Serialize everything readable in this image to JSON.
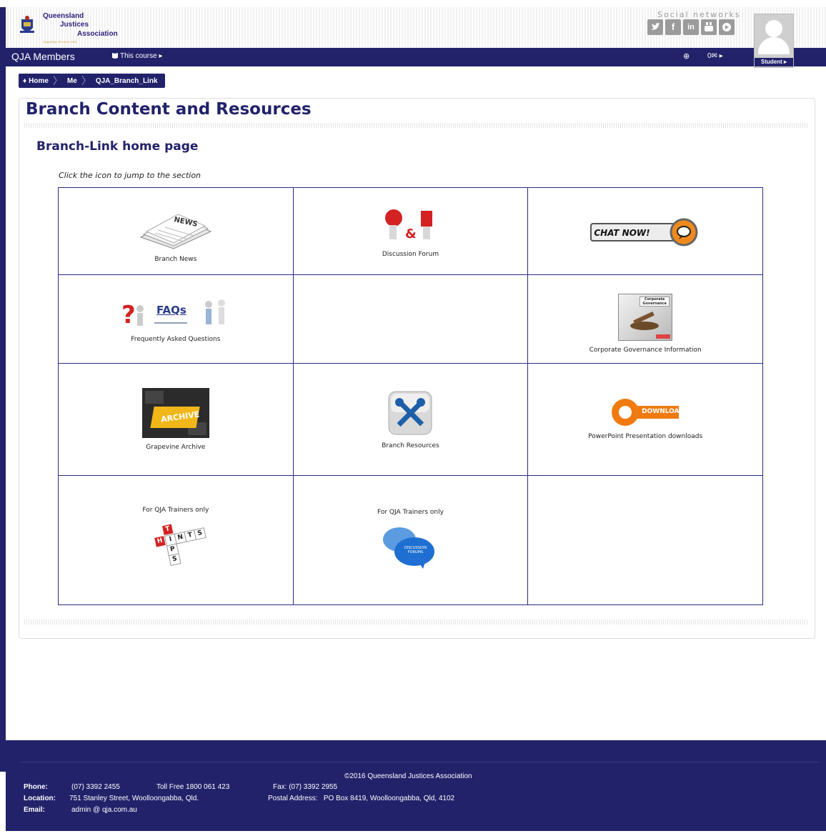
{
  "site": {
    "logo_line1": "Queensland",
    "logo_line2": "Justices",
    "logo_line3": "Association",
    "logo_tagline": "Supporting JPs since 1935",
    "social_label": "Social networks",
    "social_icons": [
      "twitter-icon",
      "facebook-icon",
      "linkedin-icon",
      "youtube-icon",
      "vimeo-icon"
    ]
  },
  "navbar": {
    "brand": "QJA Members",
    "course_menu": "This course ▸",
    "language_icon": "globe-icon",
    "messages": "0✉ ▸",
    "user_label": "Student ▸"
  },
  "breadcrumb": [
    "Home",
    "Me",
    "QJA_Branch_Link"
  ],
  "page": {
    "title": "Branch Content and Resources",
    "section_title": "Branch-Link home page",
    "hint": "Click the icon to jump to the section"
  },
  "tiles": {
    "news": "Branch News",
    "forum": "Discussion Forum",
    "chat": "CHAT NOW!",
    "faqs": "Frequently Asked Questions",
    "faqs_icon_text": "FAQs",
    "governance": "Corporate Governance Information",
    "governance_icon_text": "Corporate Governance",
    "archive": "Grapevine Archive",
    "archive_icon_text": "ARCHIVE",
    "resources": "Branch Resources",
    "download": "PowerPoint Presentation downloads",
    "download_icon_text": "DOWNLOAD",
    "trainers1": "For QJA Trainers only",
    "trainers2": "For QJA Trainers only",
    "tips_letters": [
      "T",
      "I",
      "P",
      "S",
      "H",
      "N",
      "T",
      "S"
    ],
    "bubble_text": "DISCUSSION FORUMS"
  },
  "footer": {
    "copyright": "©2016 Queensland Justices Association",
    "phone_label": "Phone:",
    "phone": "(07) 3392 2455",
    "tollfree": "Toll Free 1800 061 423",
    "fax": "Fax: (07) 3392 2955",
    "location_label": "Location:",
    "location": "751 Stanley Street, Woolloongabba, Qld.",
    "postal": "Postal Address:   PO Box 8419, Woolloongabba, Qld, 4102",
    "email_label": "Email:",
    "email": "admin @ qja.com.au"
  },
  "colors": {
    "brand_navy": "#22226b",
    "grid_border": "#2a2a80",
    "download_orange": "#f07a10"
  }
}
